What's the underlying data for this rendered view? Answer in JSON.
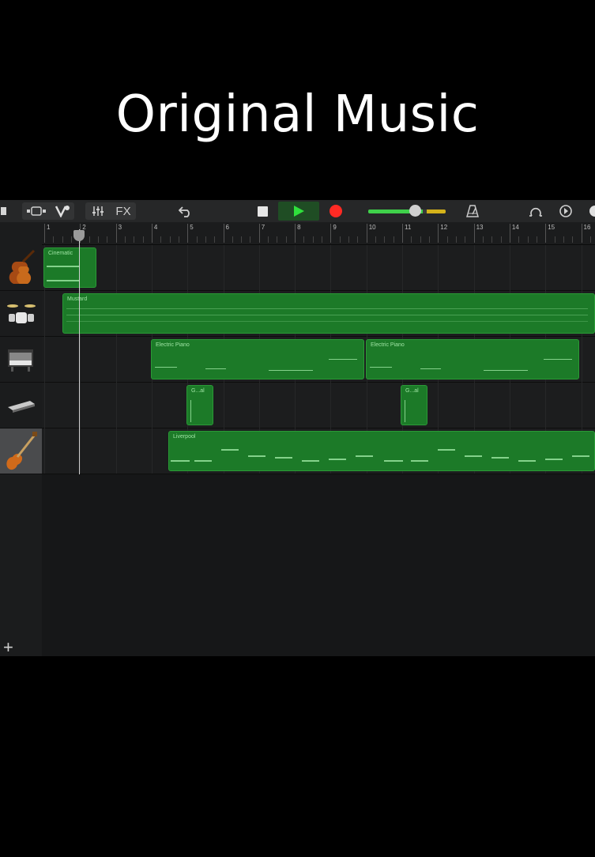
{
  "caption": "Original Music",
  "toolbar": {
    "fx_label": "FX",
    "icons": [
      "my-songs-icon",
      "browser-icon",
      "track-controls-icon",
      "mixer-icon",
      "undo-icon",
      "stop-icon",
      "play-icon",
      "record-icon",
      "metronome-icon",
      "loop-icon",
      "settings-icon",
      "help-icon"
    ],
    "master_volume": 0.7
  },
  "ruler": {
    "bars": [
      "1",
      "2",
      "3",
      "4",
      "5",
      "6",
      "7",
      "8",
      "9",
      "10",
      "11",
      "12",
      "13",
      "14",
      "15",
      "16"
    ]
  },
  "tracks": [
    {
      "instrument": "violin-icon",
      "regions": [
        {
          "label": "Cinematic"
        }
      ]
    },
    {
      "instrument": "drum-kit-icon",
      "regions": [
        {
          "label": "Mustard"
        }
      ]
    },
    {
      "instrument": "electric-piano-icon",
      "regions": [
        {
          "label": "Electric Piano"
        },
        {
          "label": "Electric Piano"
        }
      ]
    },
    {
      "instrument": "synth-keyboard-icon",
      "regions": [
        {
          "label": "G...al"
        },
        {
          "label": "G...al"
        }
      ]
    },
    {
      "instrument": "electric-guitar-icon",
      "selected": true,
      "regions": [
        {
          "label": "Liverpool"
        }
      ]
    }
  ],
  "add_track_label": "+",
  "colors": {
    "region": "#1c7a28",
    "record": "#ff2a24",
    "play": "#2fe03c",
    "background": "#000000"
  }
}
